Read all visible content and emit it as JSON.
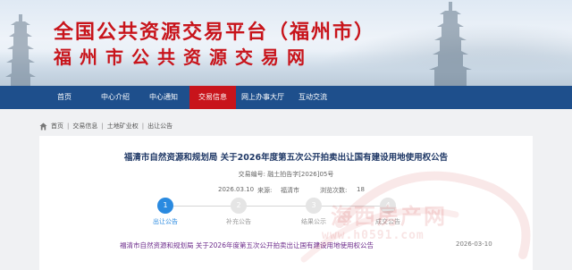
{
  "header": {
    "title": "全国公共资源交易平台（福州市）",
    "subtitle": "福州市公共资源交易网"
  },
  "nav": {
    "items": [
      {
        "label": "首页"
      },
      {
        "label": "中心介绍"
      },
      {
        "label": "中心通知"
      },
      {
        "label": "交易信息",
        "active": true
      },
      {
        "label": "网上办事大厅"
      },
      {
        "label": "互动交流"
      }
    ]
  },
  "breadcrumb": [
    "首页",
    "交易信息",
    "土地矿业权",
    "出让公告"
  ],
  "article": {
    "title": "福清市自然资源和规划局 关于2026年度第五次公开拍卖出让国有建设用地使用权公告",
    "number": "交易编号: 融土拍告字[2026]05号",
    "date_label": "2026.03.10",
    "source_label": "来源:",
    "source_value": "福清市",
    "views_label": "浏览次数:",
    "views_value": "18"
  },
  "steps": [
    {
      "num": "1",
      "label": "出让公告",
      "active": true
    },
    {
      "num": "2",
      "label": "补充公告",
      "active": false
    },
    {
      "num": "3",
      "label": "结果公示",
      "active": false
    },
    {
      "num": "4",
      "label": "成交公告",
      "active": false
    }
  ],
  "related": {
    "link": "福清市自然资源和规划局 关于2026年度第五次公开拍卖出让国有建设用地使用权公告",
    "date": "2026-03-10"
  },
  "watermark": {
    "text": "海西房产网",
    "url": "www.h0591.com"
  },
  "colors": {
    "nav_bg": "#1e4f8c",
    "nav_active": "#c8141b",
    "title_red": "#c8141b",
    "step_active": "#2a8ae0"
  }
}
